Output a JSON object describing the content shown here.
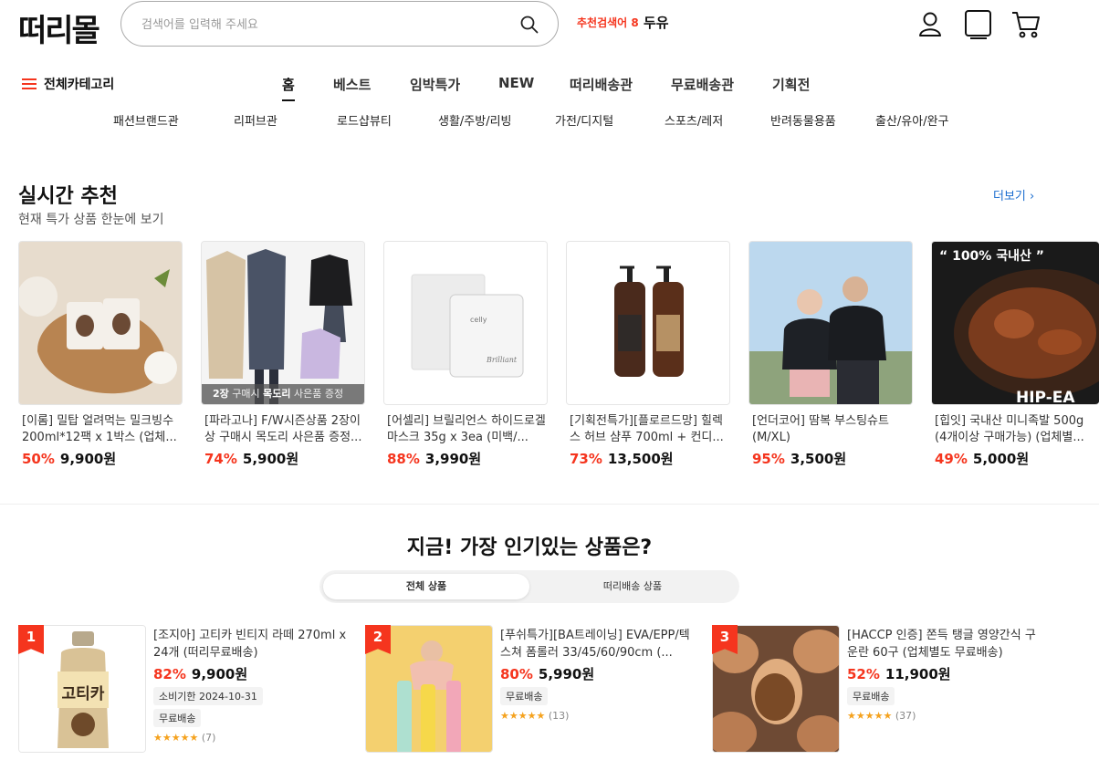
{
  "header": {
    "logo": "떠리몰",
    "search_placeholder": "검색어를 입력해 주세요",
    "recommended_label": "추천검색어 8",
    "recommended_word": "두유"
  },
  "nav": {
    "all_categories": "전체카테고리",
    "items": [
      "홈",
      "베스트",
      "임박특가",
      "NEW",
      "떠리배송관",
      "무료배송관",
      "기획전"
    ],
    "subcategories": [
      "패션브랜드관",
      "리퍼브관",
      "로드샵뷰티",
      "생활/주방/리빙",
      "가전/디지털",
      "스포츠/레저",
      "반려동물용품",
      "출산/유아/완구"
    ]
  },
  "realtime": {
    "title": "실시간 추천",
    "subtitle": "현재 특가 상품 한눈에 보기",
    "more": "더보기",
    "products": [
      {
        "name": "[이롬] 밀탑 얼려먹는 밀크빙수 200ml*12팩 x 1박스 (업체...",
        "discount": "50%",
        "price": "9,900원"
      },
      {
        "name": "[파라고나] F/W시즌상품 2장이상 구매시 목도리 사은품 증정...",
        "discount": "74%",
        "price": "5,900원",
        "banner_strong1": "2장",
        "banner_text1": " 구매시 ",
        "banner_strong2": "목도리",
        "banner_text2": " 사은품 증정"
      },
      {
        "name": "[어셀리] 브릴리언스 하이드로겔 마스크 35g x 3ea (미백/...",
        "discount": "88%",
        "price": "3,990원"
      },
      {
        "name": "[기획전특가][플로르드망] 힐렉스 허브 샴푸 700ml + 컨디...",
        "discount": "73%",
        "price": "13,500원"
      },
      {
        "name": "[언더코어] 땀복 부스팅슈트 (M/XL)",
        "discount": "95%",
        "price": "3,500원"
      },
      {
        "name": "[힙잇] 국내산 미니족발 500g (4개이상 구매가능) (업체별...",
        "discount": "49%",
        "price": "5,000원",
        "image_text1": "“ 100% 국내산 ”",
        "image_text2": "HIP-EA"
      }
    ]
  },
  "popular": {
    "title": "지금! 가장 인기있는 상품은?",
    "tabs": [
      "전체 상품",
      "떠리배송 상품"
    ],
    "items": [
      {
        "rank": "1",
        "name": "[조지아] 고티카 빈티지 라떼 270ml x 24개 (떠리무료배송)",
        "discount": "82%",
        "price": "9,900원",
        "expiry": "소비기한 2024-10-31",
        "tag": "무료배송",
        "reviews": "(7)",
        "can_text": "고티카"
      },
      {
        "rank": "2",
        "name": "[푸쉬특가][BA트레이닝] EVA/EPP/텍스쳐 폼롤러 33/45/60/90cm (...",
        "discount": "80%",
        "price": "5,990원",
        "tag": "무료배송",
        "reviews": "(13)"
      },
      {
        "rank": "3",
        "name": "[HACCP 인증] 쫀득 탱글 영양간식 구운란 60구 (업체별도 무료배송)",
        "discount": "52%",
        "price": "11,900원",
        "tag": "무료배송",
        "reviews": "(37)"
      }
    ]
  },
  "colors": {
    "accent": "#f5351e",
    "link": "#1a6ccf",
    "star": "#f5a21e"
  }
}
